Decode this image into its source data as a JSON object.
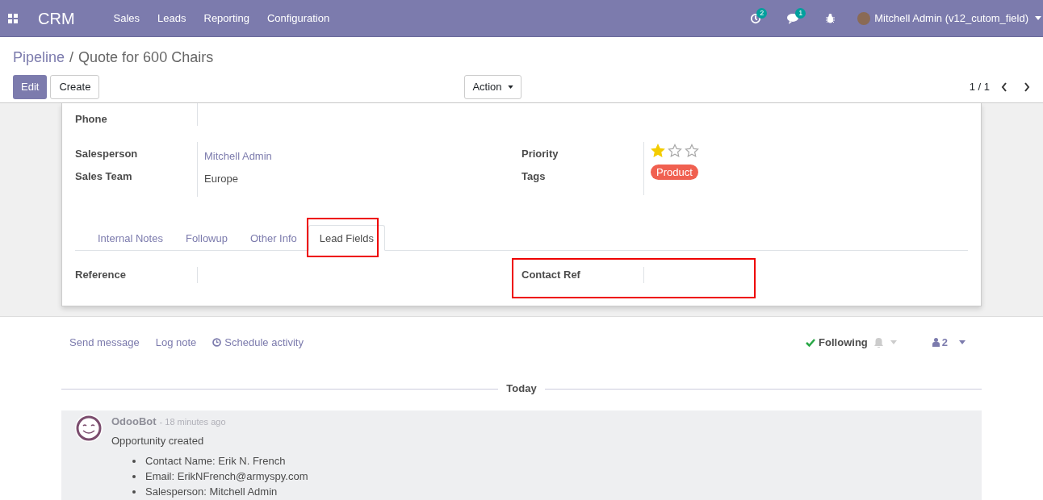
{
  "navbar": {
    "app": "CRM",
    "menu": [
      "Sales",
      "Leads",
      "Reporting",
      "Configuration"
    ],
    "activity_count": "2",
    "message_count": "1",
    "user": "Mitchell Admin (v12_cutom_field)"
  },
  "breadcrumb": {
    "parent": "Pipeline",
    "separator": "/",
    "current": "Quote for 600 Chairs"
  },
  "buttons": {
    "edit": "Edit",
    "create": "Create",
    "action": "Action"
  },
  "pager": "1 / 1",
  "form": {
    "phone_label": "Phone",
    "left": [
      {
        "label": "Salesperson",
        "value": "Mitchell Admin",
        "kind": "link"
      },
      {
        "label": "Sales Team",
        "value": "Europe",
        "kind": "text"
      }
    ],
    "priority": {
      "label": "Priority",
      "stars": 1
    },
    "tags": {
      "label": "Tags",
      "items": [
        {
          "label": "Product",
          "color": "#f06050"
        }
      ]
    },
    "tabs": [
      {
        "label": "Internal Notes",
        "selected": false
      },
      {
        "label": "Followup",
        "selected": false
      },
      {
        "label": "Other Info",
        "selected": false
      },
      {
        "label": "Lead Fields",
        "selected": true
      }
    ],
    "fields": [
      {
        "label": "Reference"
      },
      {
        "label": "Contact Ref"
      }
    ]
  },
  "chatter": {
    "actions": [
      "Send message",
      "Log note",
      "Schedule activity"
    ],
    "following": "Following",
    "followers": "2",
    "date": "Today",
    "message": {
      "author": "OdooBot",
      "time": "- 18 minutes ago",
      "body": "Opportunity created",
      "items": [
        "Contact Name: Erik N. French",
        "Email: ErikNFrench@armyspy.com",
        "Salesperson: Mitchell Admin"
      ]
    }
  }
}
